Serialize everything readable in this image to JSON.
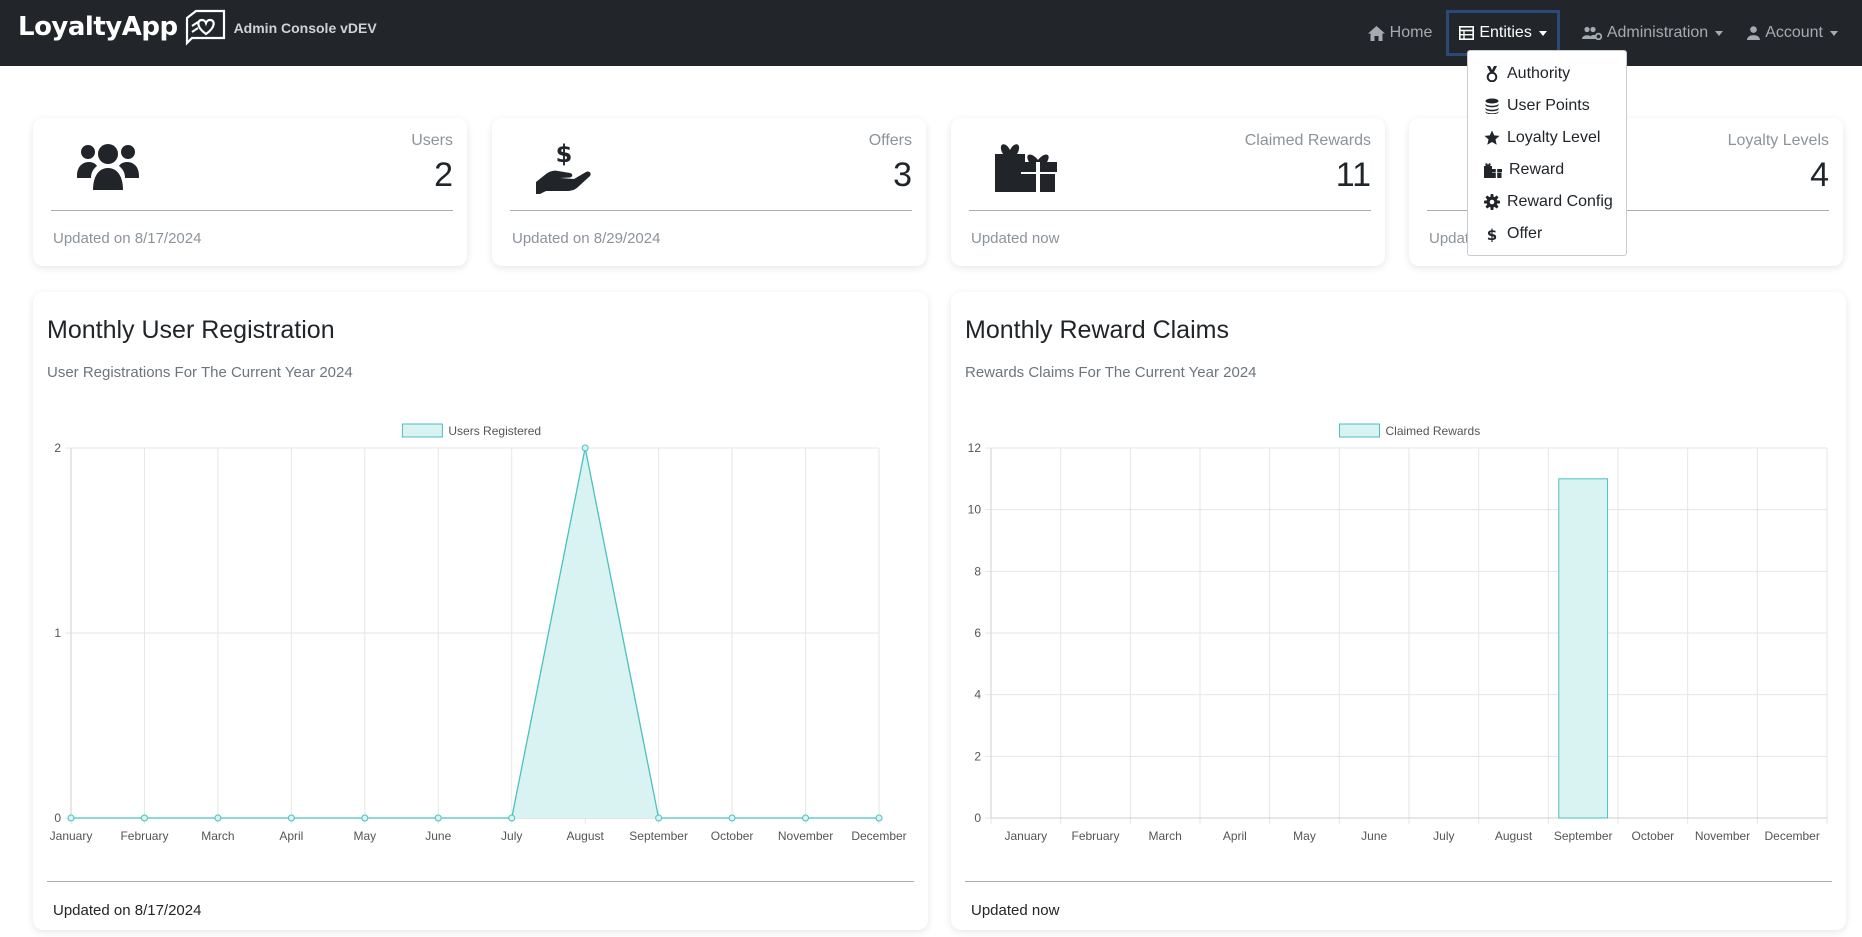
{
  "navbar": {
    "brand": "LoyaltyApp",
    "subtitle": "Admin Console vDEV",
    "items": [
      {
        "label": "Home",
        "icon": "home-icon"
      },
      {
        "label": "Entities",
        "icon": "table-icon",
        "active": true
      },
      {
        "label": "Administration",
        "icon": "users-cog-icon"
      },
      {
        "label": "Account",
        "icon": "user-icon"
      }
    ]
  },
  "entities_menu": [
    {
      "label": "Authority",
      "icon": "medal-icon"
    },
    {
      "label": "User Points",
      "icon": "coins-icon"
    },
    {
      "label": "Loyalty Level",
      "icon": "star-icon"
    },
    {
      "label": "Reward",
      "icon": "gifts-icon"
    },
    {
      "label": "Reward Config",
      "icon": "gear-icon"
    },
    {
      "label": "Offer",
      "icon": "dollar-icon"
    }
  ],
  "stats": [
    {
      "label": "Users",
      "value": "2",
      "footer": "Updated on 8/17/2024",
      "icon": "users-icon"
    },
    {
      "label": "Offers",
      "value": "3",
      "footer": "Updated on 8/29/2024",
      "icon": "hand-dollar-icon"
    },
    {
      "label": "Claimed Rewards",
      "value": "11",
      "footer": "Updated now",
      "icon": "gifts-icon"
    },
    {
      "label": "Loyalty Levels",
      "value": "4",
      "footer": "Updated",
      "icon": "trophy-icon"
    }
  ],
  "charts": [
    {
      "title": "Monthly User Registration",
      "subtitle": "User Registrations For The Current Year 2024",
      "footer": "Updated on 8/17/2024"
    },
    {
      "title": "Monthly Reward Claims",
      "subtitle": "Rewards Claims For The Current Year 2024",
      "footer": "Updated now"
    }
  ],
  "colors": {
    "series_stroke": "#4bc0c0",
    "series_fill": "#d9f2f2",
    "navbar_bg": "#22262a"
  },
  "chart_data": [
    {
      "type": "area",
      "categories": [
        "January",
        "February",
        "March",
        "April",
        "May",
        "June",
        "July",
        "August",
        "September",
        "October",
        "November",
        "December"
      ],
      "series": [
        {
          "name": "Users Registered",
          "values": [
            0,
            0,
            0,
            0,
            0,
            0,
            0,
            2,
            0,
            0,
            0,
            0
          ]
        }
      ],
      "ylim": [
        0,
        2
      ],
      "yticks": [
        0,
        1,
        2
      ],
      "grid": true,
      "legend": "top"
    },
    {
      "type": "bar",
      "categories": [
        "January",
        "February",
        "March",
        "April",
        "May",
        "June",
        "July",
        "August",
        "September",
        "October",
        "November",
        "December"
      ],
      "series": [
        {
          "name": "Claimed Rewards",
          "values": [
            0,
            0,
            0,
            0,
            0,
            0,
            0,
            0,
            11,
            0,
            0,
            0
          ]
        }
      ],
      "ylim": [
        0,
        12
      ],
      "yticks": [
        0,
        2,
        4,
        6,
        8,
        10,
        12
      ],
      "grid": true,
      "legend": "top"
    }
  ]
}
